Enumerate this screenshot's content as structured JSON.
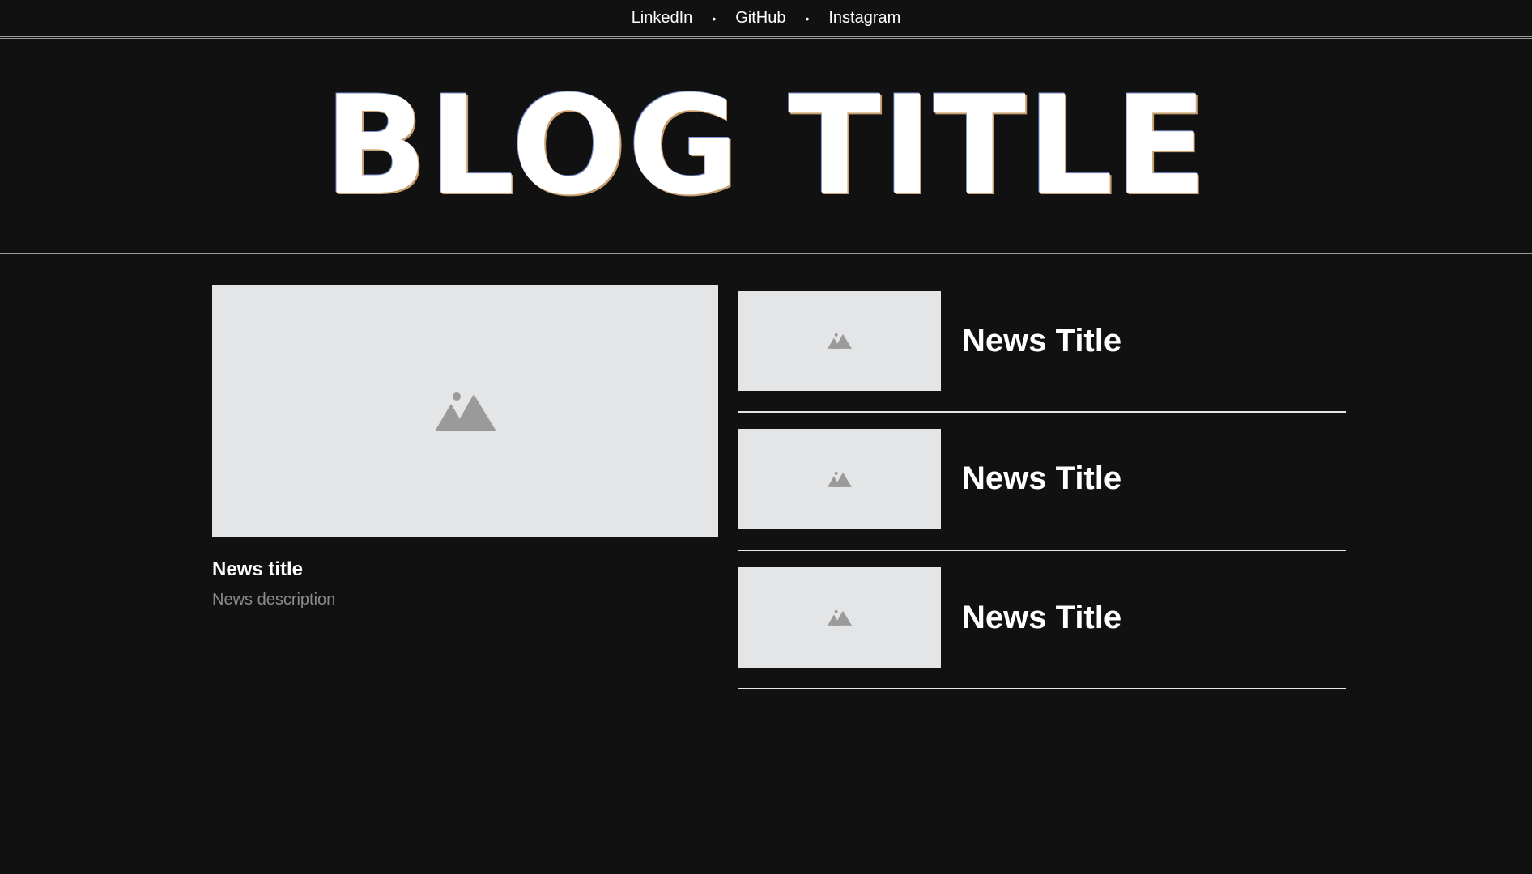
{
  "nav": {
    "links": [
      {
        "label": "LinkedIn"
      },
      {
        "label": "GitHub"
      },
      {
        "label": "Instagram"
      }
    ],
    "separator": "•"
  },
  "hero": {
    "title": "BLOG TITLE"
  },
  "featured": {
    "image_icon": "image-placeholder-icon",
    "title": "News title",
    "description": "News description"
  },
  "news_list": [
    {
      "title": "News Title",
      "image_icon": "image-placeholder-icon"
    },
    {
      "title": "News Title",
      "image_icon": "image-placeholder-icon"
    },
    {
      "title": "News Title",
      "image_icon": "image-placeholder-icon"
    }
  ],
  "colors": {
    "background": "#111111",
    "placeholder_bg": "#e4e5e7",
    "placeholder_icon": "#9a9a9a",
    "description_text": "#8a8a8a"
  }
}
